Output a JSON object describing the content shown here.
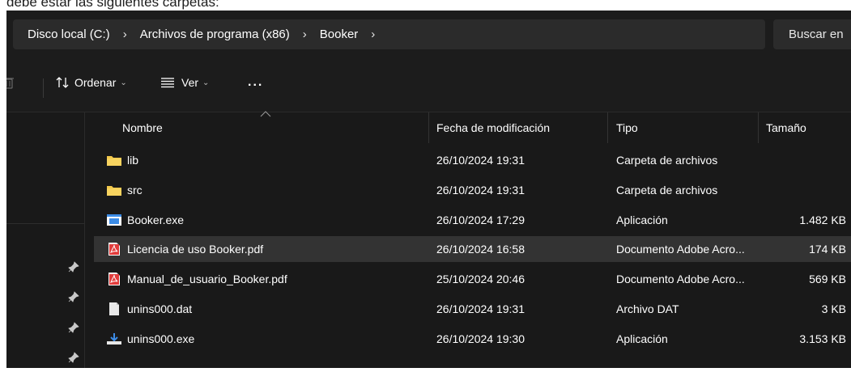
{
  "caption": "debe estar las siguientes carpetas:",
  "address": {
    "crumbs": [
      "Disco local (C:)",
      "Archivos de programa (x86)",
      "Booker"
    ],
    "separator": "›",
    "search_placeholder": "Buscar en"
  },
  "toolbar": {
    "sort_label": "Ordenar",
    "view_label": "Ver",
    "more_label": "..."
  },
  "columns": {
    "name": "Nombre",
    "date": "Fecha de modificación",
    "type": "Tipo",
    "size": "Tamaño"
  },
  "files": [
    {
      "name": "lib",
      "date": "26/10/2024 19:31",
      "type": "Carpeta de archivos",
      "size": "",
      "icon": "folder-icon"
    },
    {
      "name": "src",
      "date": "26/10/2024 19:31",
      "type": "Carpeta de archivos",
      "size": "",
      "icon": "folder-icon"
    },
    {
      "name": "Booker.exe",
      "date": "26/10/2024 17:29",
      "type": "Aplicación",
      "size": "1.482 KB",
      "icon": "application-icon"
    },
    {
      "name": "Licencia de uso Booker.pdf",
      "date": "26/10/2024 16:58",
      "type": "Documento Adobe Acro...",
      "size": "174 KB",
      "icon": "pdf-icon",
      "selected": true
    },
    {
      "name": "Manual_de_usuario_Booker.pdf",
      "date": "25/10/2024 20:46",
      "type": "Documento Adobe Acro...",
      "size": "569 KB",
      "icon": "pdf-icon"
    },
    {
      "name": "unins000.dat",
      "date": "26/10/2024 19:31",
      "type": "Archivo DAT",
      "size": "3 KB",
      "icon": "file-icon"
    },
    {
      "name": "unins000.exe",
      "date": "26/10/2024 19:30",
      "type": "Aplicación",
      "size": "3.153 KB",
      "icon": "installer-icon"
    }
  ],
  "colors": {
    "background": "#191919",
    "selected_row": "#333333",
    "folder": "#f2c84b",
    "pdf": "#e23c3c",
    "app_blue": "#3c8ce7"
  }
}
